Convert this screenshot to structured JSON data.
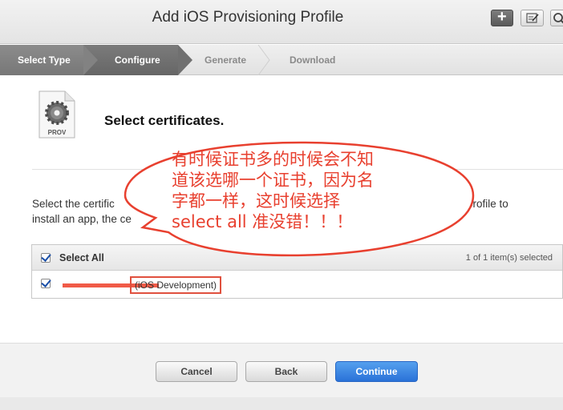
{
  "window": {
    "title": "Add iOS Provisioning Profile"
  },
  "toolbar": {
    "add_icon": "plus-icon",
    "edit_icon": "edit-icon",
    "search_icon": "search-icon"
  },
  "steps": [
    {
      "label": "Select Type",
      "state": "completed"
    },
    {
      "label": "Configure",
      "state": "active"
    },
    {
      "label": "Generate",
      "state": "pending"
    },
    {
      "label": "Download",
      "state": "pending"
    }
  ],
  "file_icon": {
    "label": "PROV",
    "icon": "gear-document-icon"
  },
  "main": {
    "heading": "Select certificates.",
    "description_left_line1": "Select the certific",
    "description_right_line1": "profile to",
    "description_line2": "install an app, the ce"
  },
  "table": {
    "header": {
      "select_all_label": "Select All",
      "count": "1 of 1 item(s) selected"
    },
    "rows": [
      {
        "checked": true,
        "name": "",
        "type": "(iOS Development)"
      }
    ]
  },
  "buttons": {
    "cancel": "Cancel",
    "back": "Back",
    "continue": "Continue"
  },
  "annotation": {
    "line1": "有时候证书多的时候会不知",
    "line2": "道该选哪一个证书，因为名",
    "line3": "字都一样，这时候选择",
    "line4": "select all 准没错！！！"
  },
  "colors": {
    "accent": "#2a72d8",
    "annotation": "#e8402f"
  }
}
